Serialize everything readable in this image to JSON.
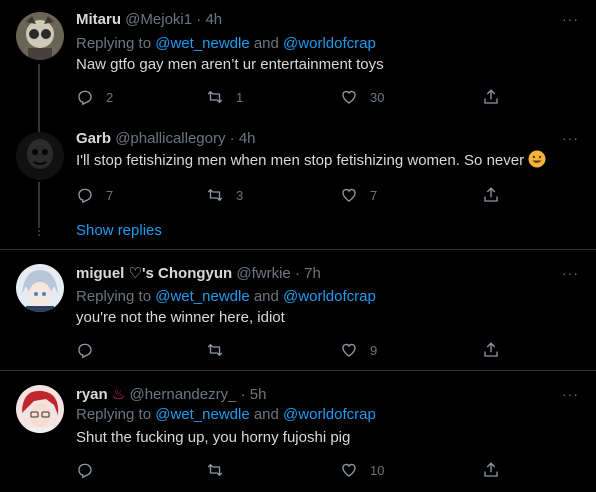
{
  "tweets": [
    {
      "name": "Mitaru",
      "handle": "@Mejoki1",
      "sep": "·",
      "time": "4h",
      "replying_prefix": "Replying to ",
      "mention1": "@wet_newdle",
      "and": " and ",
      "mention2": "@worldofcrap",
      "text": "Naw gtfo gay men aren’t ur entertainment toys",
      "replies": "2",
      "retweets": "1",
      "likes": "30"
    },
    {
      "name": "Garb",
      "handle": "@phallicallegory",
      "sep": "·",
      "time": "4h",
      "text": "I'll stop fetishizing men when men stop fetishizing women. So never",
      "replies": "7",
      "retweets": "3",
      "likes": "7"
    },
    {
      "name": "miguel ♡'s Chongyun",
      "handle": "@fwrkie",
      "sep": "·",
      "time": "7h",
      "replying_prefix": "Replying to ",
      "mention1": "@wet_newdle",
      "and": " and ",
      "mention2": "@worldofcrap",
      "text": "you're not the winner here, idiot",
      "replies": "",
      "retweets": "",
      "likes": "9"
    },
    {
      "name": "ryan",
      "name_emoji": "♨",
      "handle": "@hernandezry_",
      "sep": "·",
      "time": "5h",
      "replying_prefix": "Replying to ",
      "mention1": "@wet_newdle",
      "and": " and ",
      "mention2": "@worldofcrap",
      "text": "Shut the fucking up, you horny fujoshi pig",
      "replies": "",
      "retweets": "",
      "likes": "10"
    }
  ],
  "show_replies": "Show replies",
  "more_label": "···",
  "colors": {
    "background": "#000000",
    "link": "#1d9bf0",
    "muted": "#6e767d",
    "text": "#d9d9d9",
    "divider": "#2f3336"
  }
}
